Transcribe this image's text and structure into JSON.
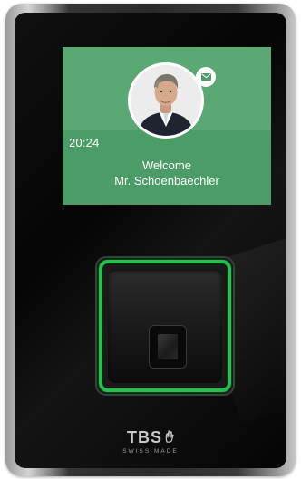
{
  "screen": {
    "time": "20:24",
    "welcome_line1": "Welcome",
    "welcome_line2": "Mr. Schoenbaechler",
    "colors": {
      "screen_green": "#5aa874",
      "led_green": "#1ec44b"
    }
  },
  "notification": {
    "icon": "mail-icon"
  },
  "brand": {
    "name": "TBS",
    "tagline": "SWISS MADE",
    "logo_icon": "tbs-hand-icon"
  }
}
